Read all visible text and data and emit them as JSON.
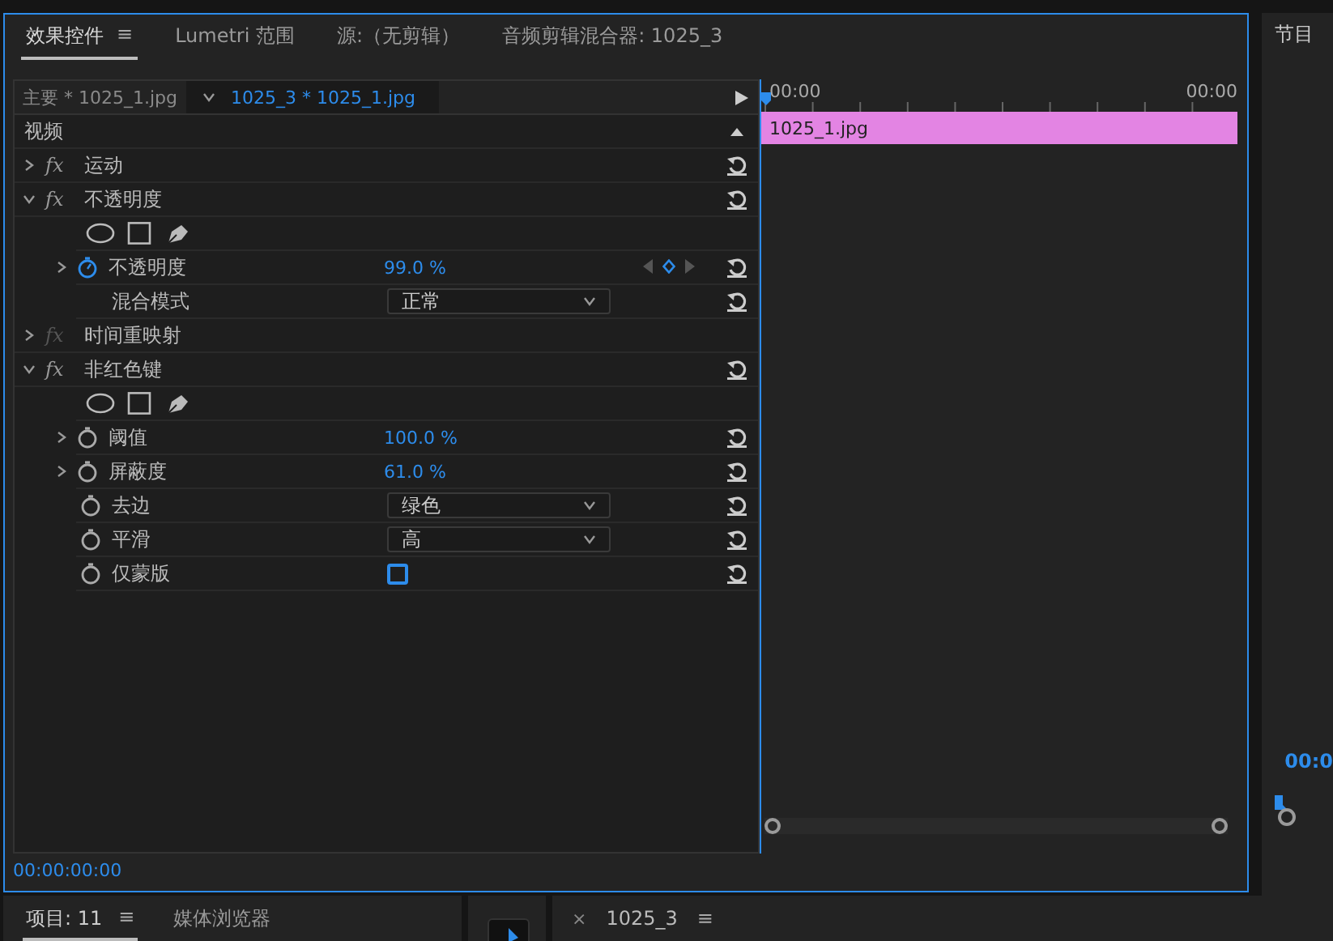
{
  "panel_tabs": [
    {
      "label": "效果控件",
      "selected": true,
      "menu": "≡"
    },
    {
      "label": "Lumetri 范围",
      "selected": false
    },
    {
      "label": "源:（无剪辑）",
      "selected": false
    },
    {
      "label": "音频剪辑混合器: 1025_3",
      "selected": false
    }
  ],
  "clip_tabs": [
    {
      "label": "主要 * 1025_1.jpg",
      "selected": false
    },
    {
      "label": "1025_3 * 1025_1.jpg",
      "selected": true
    }
  ],
  "rows": [
    {
      "kind": "section",
      "label": "视频"
    },
    {
      "kind": "effect",
      "label": "运动",
      "fx": "fx",
      "expanded": false,
      "disabled": false
    },
    {
      "kind": "effect",
      "label": "不透明度",
      "fx": "fx",
      "expanded": true,
      "disabled": false
    },
    {
      "kind": "masks"
    },
    {
      "kind": "param",
      "label": "不透明度",
      "value": "99.0 %",
      "animated": true,
      "expandable": true
    },
    {
      "kind": "dropdown",
      "label": "混合模式",
      "value": "正常"
    },
    {
      "kind": "effect",
      "label": "时间重映射",
      "fx": "fx",
      "expanded": false,
      "disabled": true
    },
    {
      "kind": "effect",
      "label": "非红色键",
      "fx": "fx",
      "expanded": true,
      "disabled": false
    },
    {
      "kind": "masks"
    },
    {
      "kind": "param",
      "label": "阈值",
      "value": "100.0 %",
      "animated": false,
      "expandable": true
    },
    {
      "kind": "param",
      "label": "屏蔽度",
      "value": "61.0 %",
      "animated": false,
      "expandable": true
    },
    {
      "kind": "dropdown",
      "label": "去边",
      "value": "绿色"
    },
    {
      "kind": "dropdown",
      "label": "平滑",
      "value": "高"
    },
    {
      "kind": "checkbox",
      "label": "仅蒙版",
      "checked": false
    }
  ],
  "timeline": {
    "ruler": [
      "00:00",
      "00:00"
    ],
    "clip": "1025_1.jpg"
  },
  "timecode": "00:00:00:00",
  "program": {
    "title": "节目",
    "timecode": "00:0"
  },
  "bottom": {
    "tabs": [
      {
        "label": "项目: 11",
        "selected": true,
        "menu": "≡"
      },
      {
        "label": "媒体浏览器",
        "selected": false
      }
    ],
    "sequence": {
      "close": "×",
      "label": "1025_3",
      "menu": "≡"
    }
  }
}
